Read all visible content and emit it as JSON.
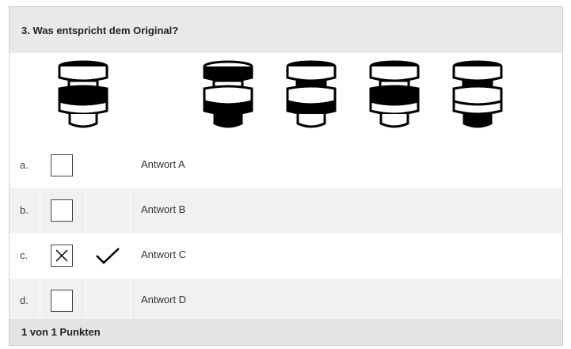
{
  "question": {
    "title": "3. Was entspricht dem Original?"
  },
  "figures": {
    "original": "stacked-disc-icon",
    "options": [
      "stacked-disc-icon",
      "stacked-disc-icon",
      "stacked-disc-icon",
      "stacked-disc-icon"
    ]
  },
  "answers": [
    {
      "letter": "a.",
      "label": "Antwort A",
      "checked": false,
      "correct": false
    },
    {
      "letter": "b.",
      "label": "Antwort B",
      "checked": false,
      "correct": false
    },
    {
      "letter": "c.",
      "label": "Antwort C",
      "checked": true,
      "correct": true
    },
    {
      "letter": "d.",
      "label": "Antwort D",
      "checked": false,
      "correct": false
    }
  ],
  "result": {
    "score": "1 von 1 Punkten"
  }
}
